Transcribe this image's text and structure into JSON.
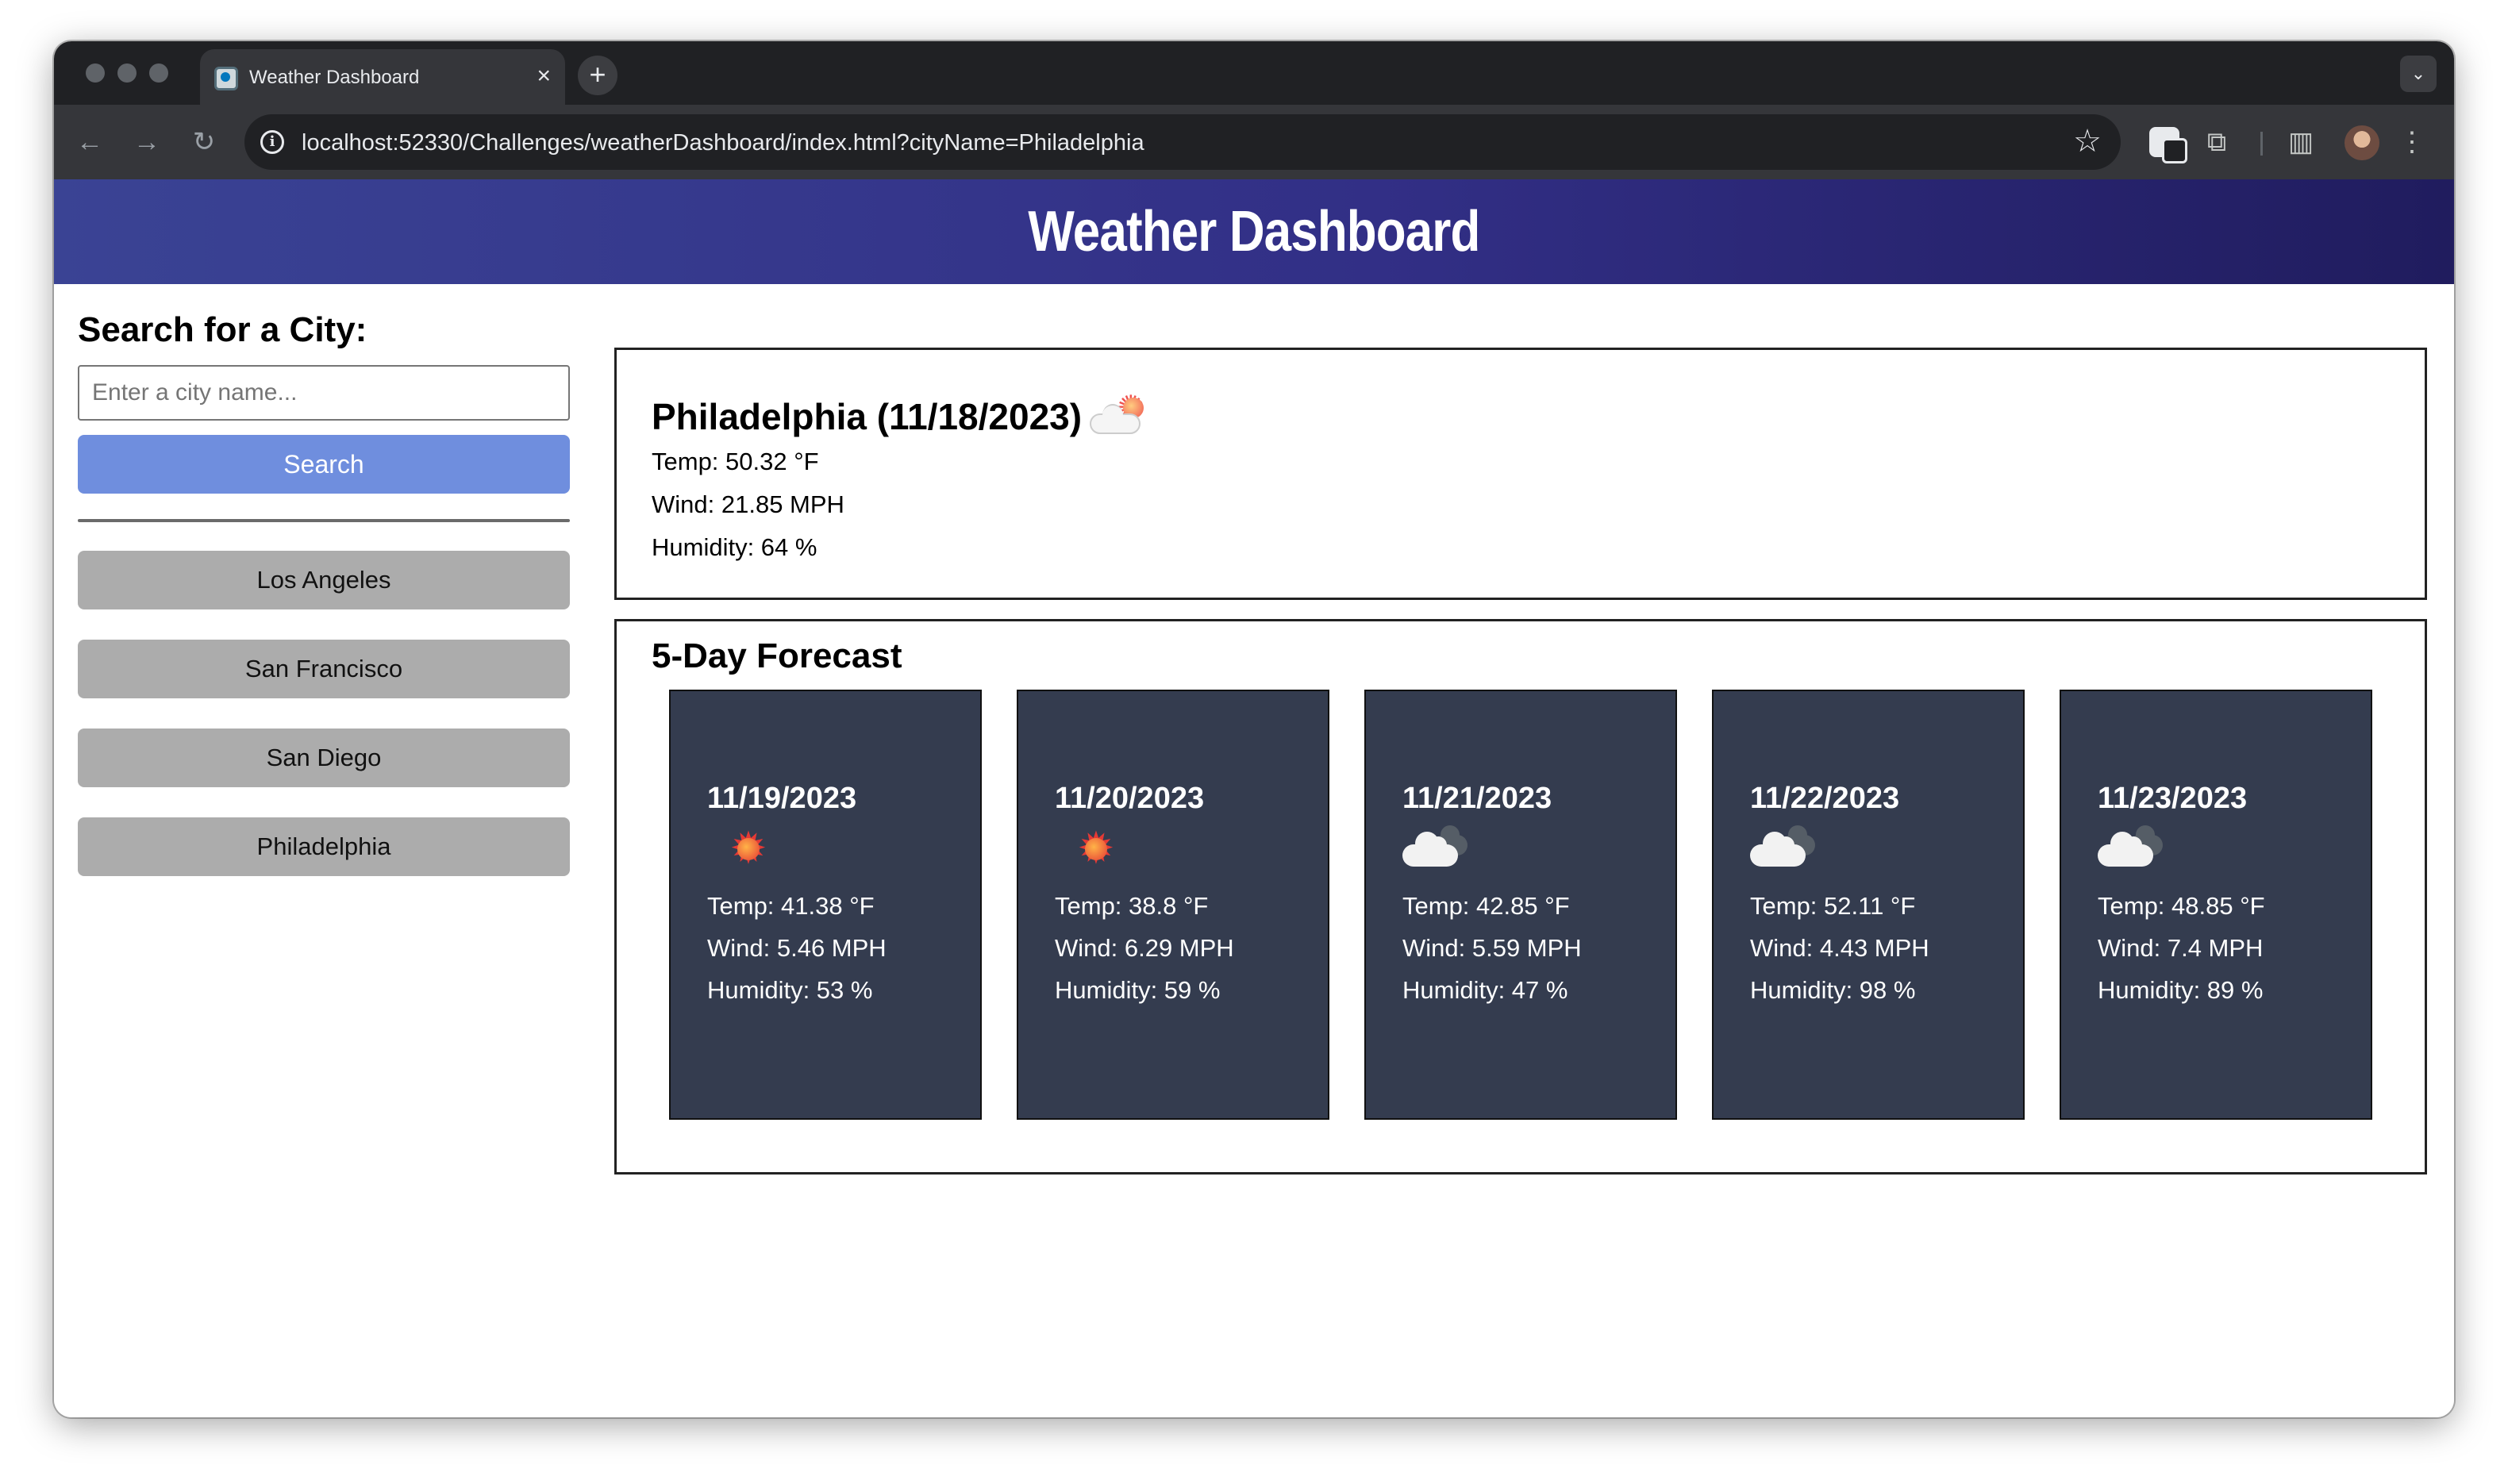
{
  "browser": {
    "tab_title": "Weather Dashboard",
    "tab_close": "×",
    "new_tab": "+",
    "tab_menu": "⌄",
    "url": "localhost:52330/Challenges/weatherDashboard/index.html?cityName=Philadelphia",
    "icons": [
      "back-arrow-icon",
      "forward-arrow-icon",
      "reload-icon",
      "site-info-icon",
      "bookmark-star-icon",
      "extensions-icon",
      "side-panel-icon",
      "profile-avatar",
      "more-menu-icon"
    ]
  },
  "header": {
    "title": "Weather Dashboard"
  },
  "sidebar": {
    "heading": "Search for a City:",
    "input_placeholder": "Enter a city name...",
    "search_label": "Search",
    "history": [
      "Los Angeles",
      "San Francisco",
      "San Diego",
      "Philadelphia"
    ]
  },
  "current": {
    "title": "Philadelphia (11/18/2023)",
    "icon": "few-clouds-icon",
    "temp": "Temp: 50.32 °F",
    "wind": "Wind: 21.85 MPH",
    "humidity": "Humidity: 64 %"
  },
  "forecast": {
    "heading": "5-Day Forecast",
    "days": [
      {
        "date": "11/19/2023",
        "icon": "sun-icon",
        "temp": "Temp: 41.38 °F",
        "wind": "Wind: 5.46 MPH",
        "humidity": "Humidity: 53 %"
      },
      {
        "date": "11/20/2023",
        "icon": "sun-icon",
        "temp": "Temp: 38.8 °F",
        "wind": "Wind: 6.29 MPH",
        "humidity": "Humidity: 59 %"
      },
      {
        "date": "11/21/2023",
        "icon": "cloud-icon",
        "temp": "Temp: 42.85 °F",
        "wind": "Wind: 5.59 MPH",
        "humidity": "Humidity: 47 %"
      },
      {
        "date": "11/22/2023",
        "icon": "cloud-icon",
        "temp": "Temp: 52.11 °F",
        "wind": "Wind: 4.43 MPH",
        "humidity": "Humidity: 98 %"
      },
      {
        "date": "11/23/2023",
        "icon": "cloud-icon",
        "temp": "Temp: 48.85 °F",
        "wind": "Wind: 7.4 MPH",
        "humidity": "Humidity: 89 %"
      }
    ]
  },
  "colors": {
    "header_gradient_start": "#3a4394",
    "header_gradient_end": "#201c5e",
    "search_button": "#6f8ede",
    "history_button": "#acacac",
    "card_background": "#343c4f"
  }
}
